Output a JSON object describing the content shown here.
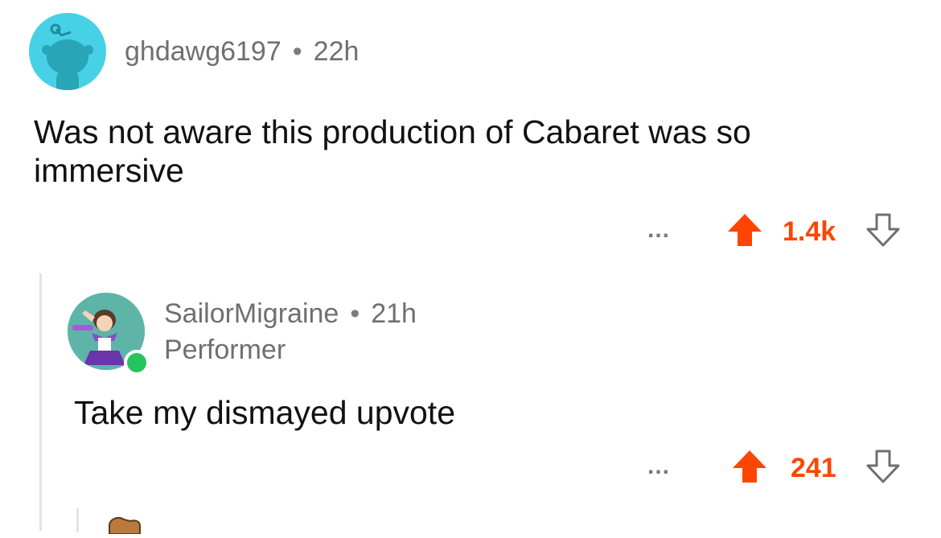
{
  "comments": [
    {
      "username": "ghdawg6197",
      "separator": "•",
      "age": "22h",
      "body": "Was not aware this production of Cabaret was so immersive",
      "actions": {
        "more": "...",
        "score": "1.4k"
      }
    },
    {
      "username": "SailorMigraine",
      "separator": "•",
      "age": "21h",
      "flair": "Performer",
      "body": "Take my dismayed upvote",
      "actions": {
        "more": "...",
        "score": "241"
      }
    }
  ],
  "colors": {
    "upvote_active": "#ff4500",
    "meta_text": "#6f6f6f",
    "avatar1_bg": "#46d1e6",
    "online_indicator": "#22c55e",
    "thread_line": "#e3e3e3"
  }
}
